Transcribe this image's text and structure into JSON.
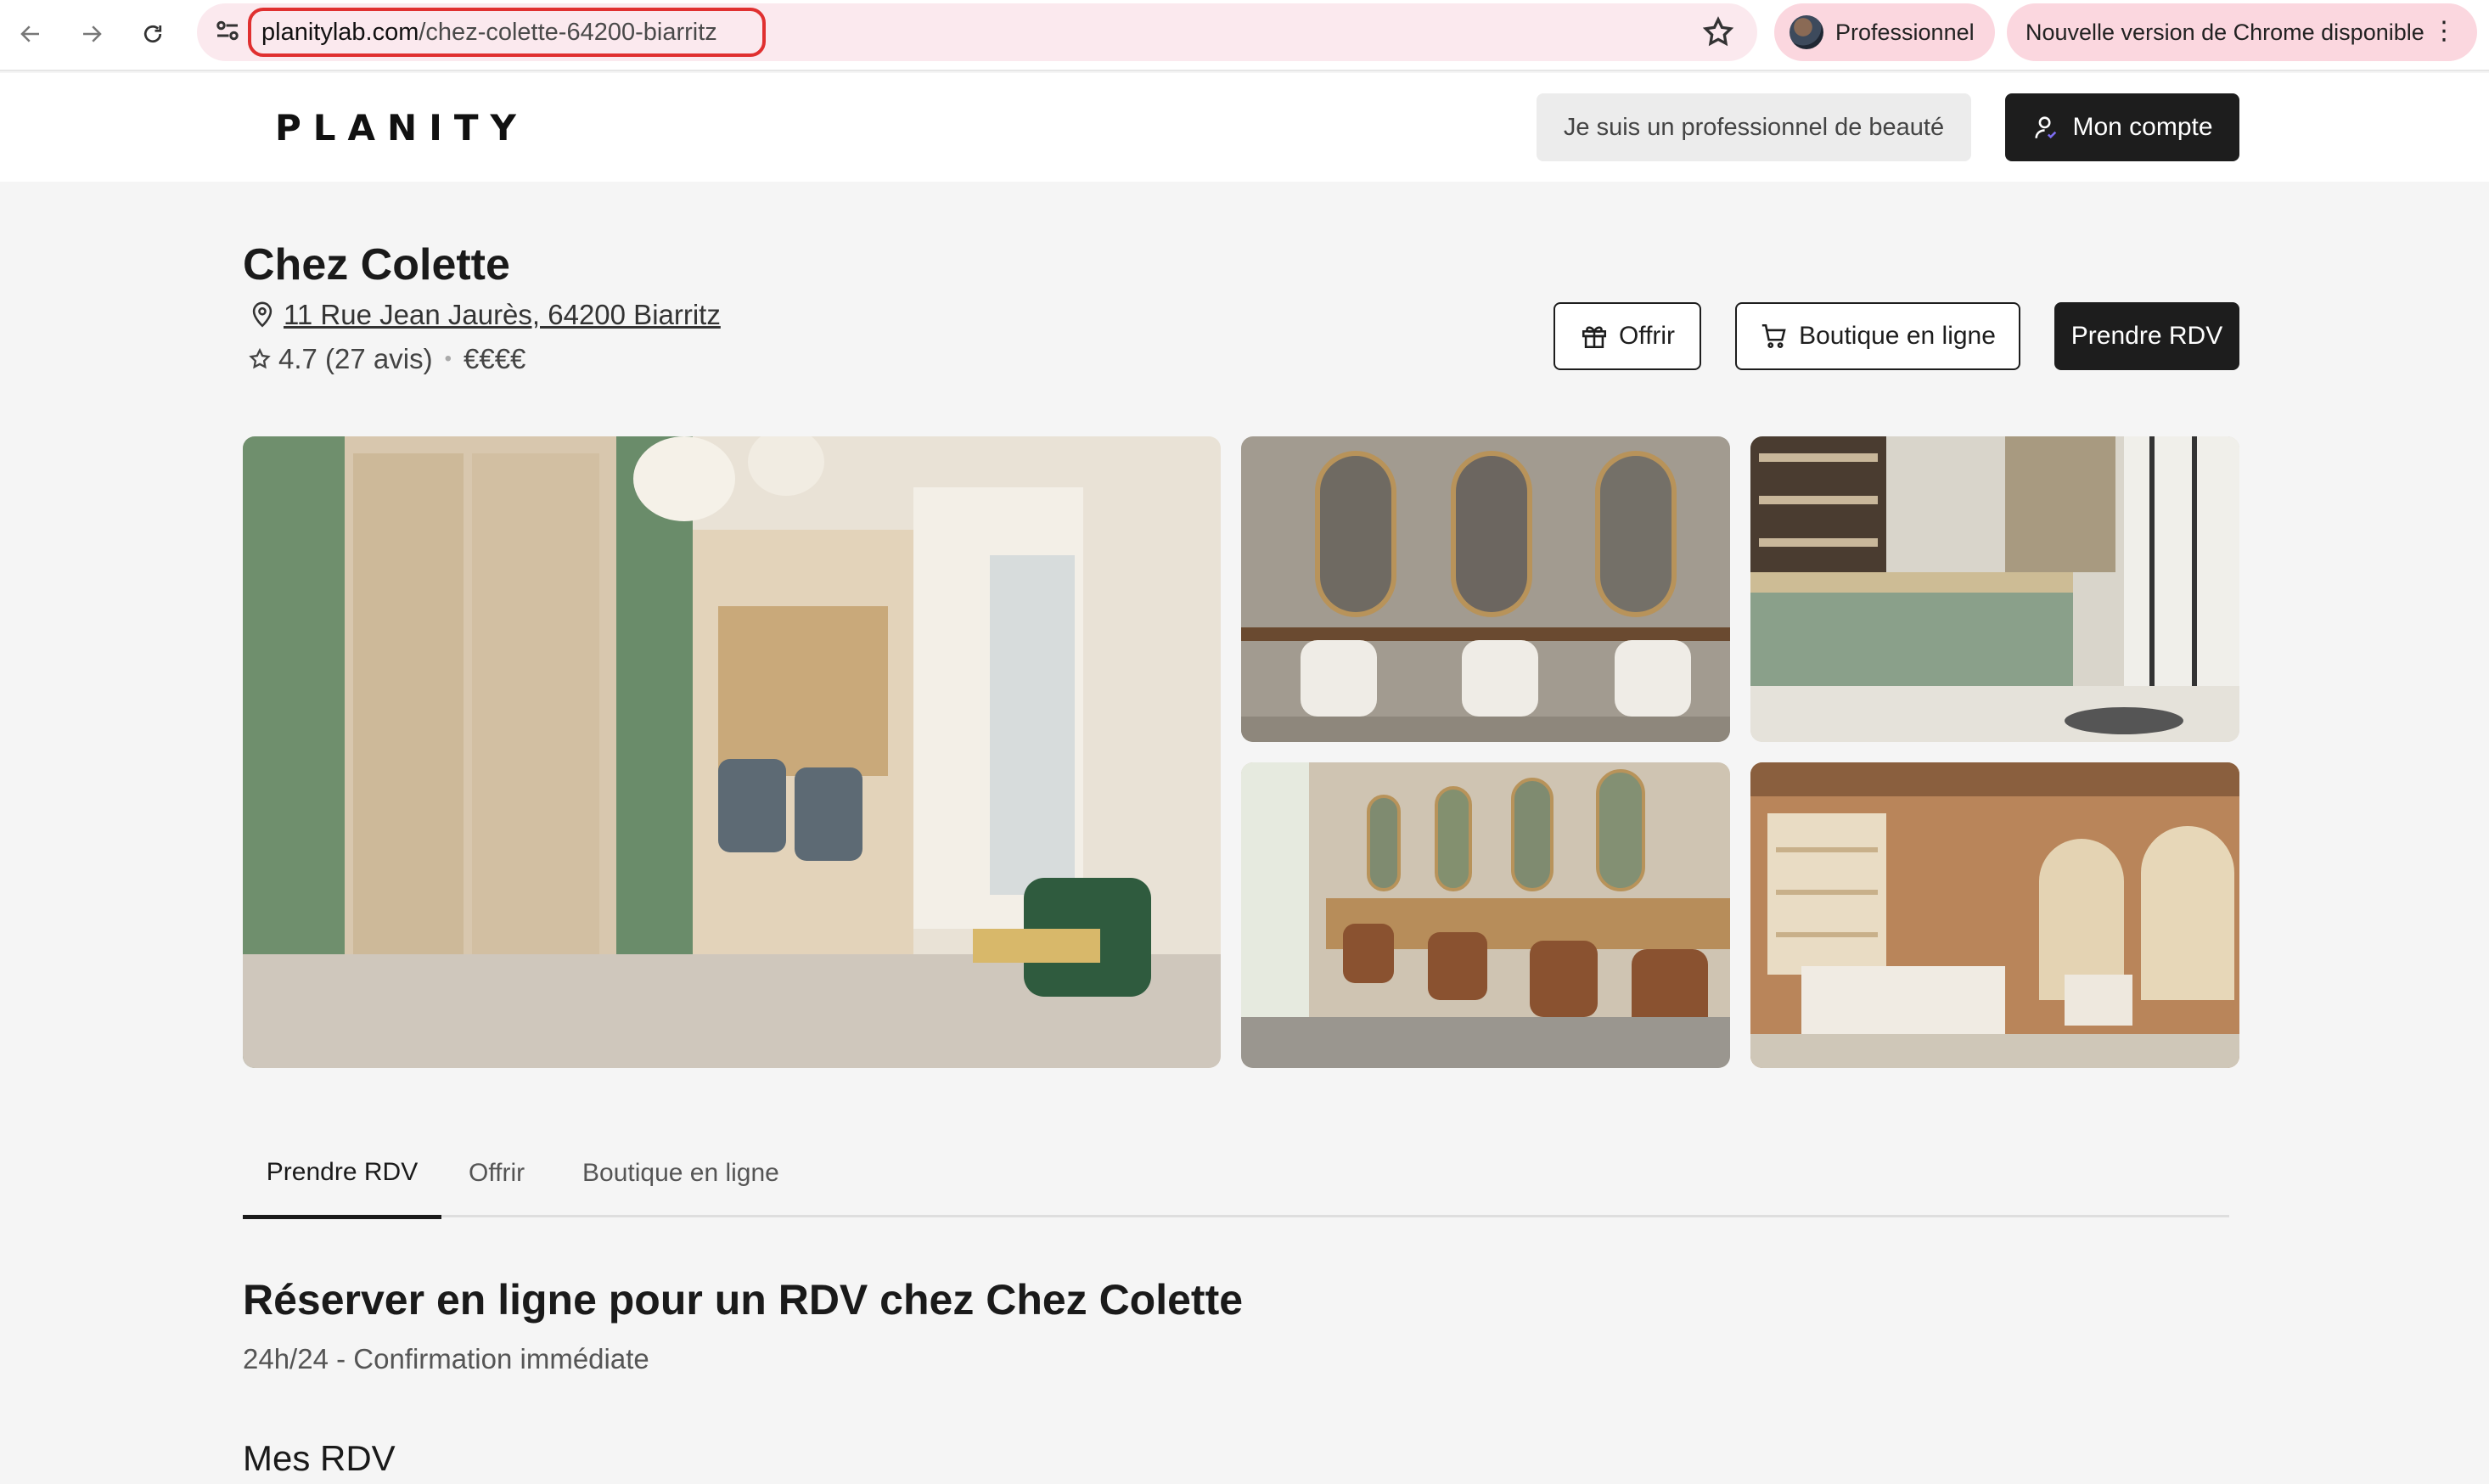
{
  "browser": {
    "url_host": "planitylab.com",
    "url_path": "/chez-colette-64200-biarritz",
    "profile_label": "Professionnel",
    "update_label": "Nouvelle version de Chrome disponible",
    "icons": [
      "back-arrow-icon",
      "forward-arrow-icon",
      "reload-icon",
      "site-info-icon",
      "bookmark-star-icon",
      "more-vert-icon"
    ]
  },
  "header": {
    "logo": "PLANITY",
    "pro_label": "Je suis un professionnel de beauté",
    "account_label": "Mon compte"
  },
  "salon": {
    "name": "Chez Colette",
    "address": "11 Rue Jean Jaurès, 64200 Biarritz",
    "rating": "4.7 (27 avis)",
    "price": "€€€€"
  },
  "actions": {
    "offer": "Offrir",
    "shop": "Boutique en ligne",
    "book": "Prendre RDV"
  },
  "gallery": [
    {
      "name": "salon-main-photo"
    },
    {
      "name": "salon-mirrors-photo"
    },
    {
      "name": "salon-reception-photo"
    },
    {
      "name": "salon-styling-stations-photo"
    },
    {
      "name": "salon-boutique-photo"
    }
  ],
  "tabs": [
    {
      "label": "Prendre RDV",
      "active": true
    },
    {
      "label": "Offrir",
      "active": false
    },
    {
      "label": "Boutique en ligne",
      "active": false
    }
  ],
  "booking": {
    "title": "Réserver en ligne pour un RDV chez Chez Colette",
    "subtitle": "24h/24 - Confirmation immédiate",
    "my_appointments": "Mes RDV"
  }
}
